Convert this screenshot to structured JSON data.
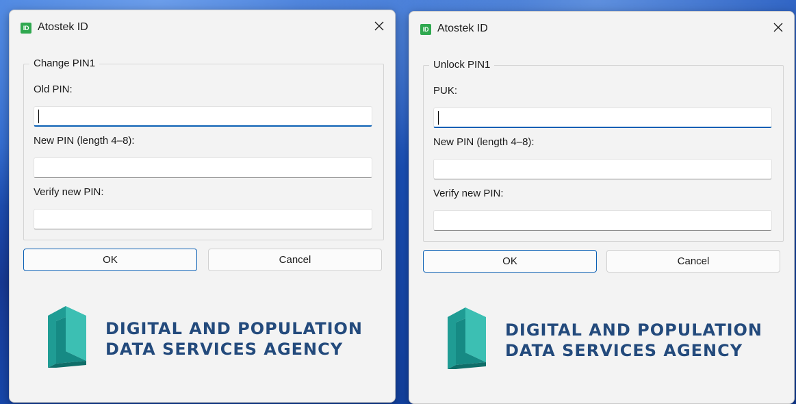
{
  "dialogs": [
    {
      "app_icon_text": "ID",
      "title": "Atostek ID",
      "group_label": "Change PIN1",
      "fields": [
        {
          "label": "Old PIN:",
          "value": ""
        },
        {
          "label": "New PIN (length 4–8):",
          "value": ""
        },
        {
          "label": "Verify new PIN:",
          "value": ""
        }
      ],
      "ok_label": "OK",
      "cancel_label": "Cancel",
      "logo": {
        "line1": "DIGITAL AND POPULATION",
        "line2": "DATA SERVICES AGENCY"
      }
    },
    {
      "app_icon_text": "ID",
      "title": "Atostek ID",
      "group_label": "Unlock PIN1",
      "fields": [
        {
          "label": "PUK:",
          "value": ""
        },
        {
          "label": "New PIN (length 4–8):",
          "value": ""
        },
        {
          "label": "Verify new PIN:",
          "value": ""
        }
      ],
      "ok_label": "OK",
      "cancel_label": "Cancel",
      "logo": {
        "line1": "DIGITAL AND POPULATION",
        "line2": "DATA SERVICES AGENCY"
      }
    }
  ],
  "icons": {
    "app": "id-app-icon",
    "close": "close-icon",
    "logo": "dvv-logo-mark"
  },
  "colors": {
    "accent": "#0a5fb4",
    "app_icon": "#2fa84f",
    "logo_text": "#234a7c",
    "logo_teal": "#1f9c94"
  }
}
